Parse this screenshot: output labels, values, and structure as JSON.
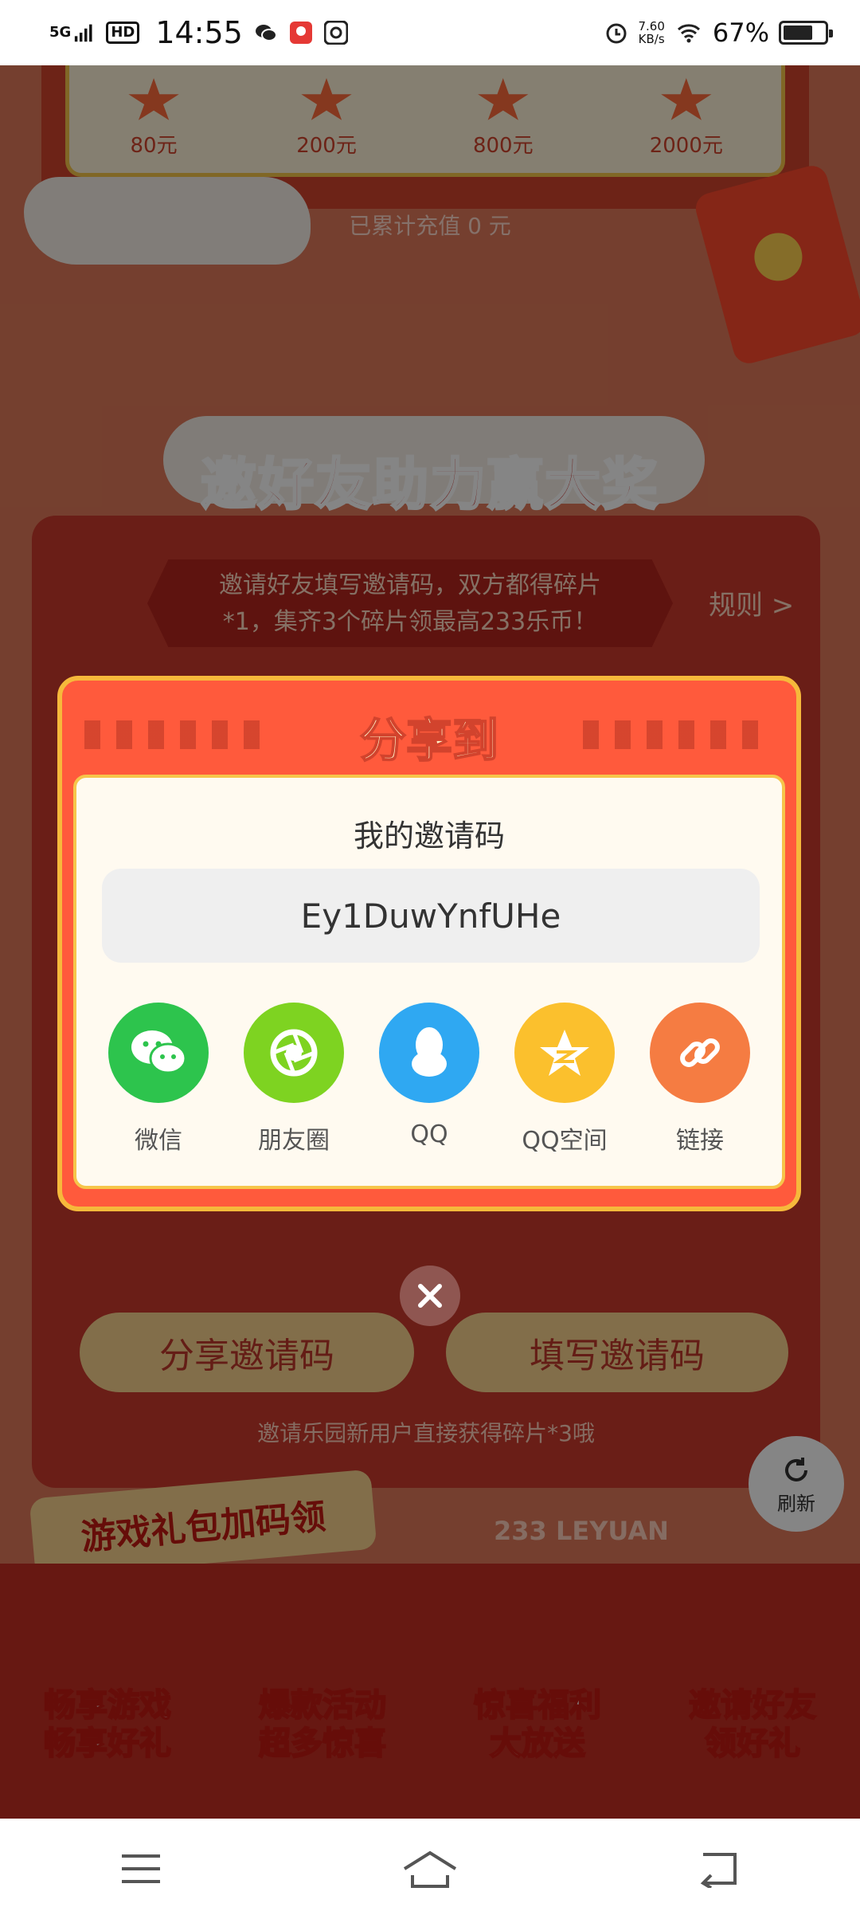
{
  "status_bar": {
    "network": "5G",
    "hd": "HD",
    "time": "14:55",
    "speed_value": "7.60",
    "speed_unit": "KB/s",
    "battery": "67%"
  },
  "background": {
    "tiers": [
      "80元",
      "200元",
      "800元",
      "2000元"
    ],
    "recharge_text": "已累计充值 0 元",
    "section_title": "邀好友助力赢大奖",
    "invite_desc_line1": "邀请好友填写邀请码，双方都得碎片",
    "invite_desc_line2": "*1，集齐3个碎片领最高233乐币！",
    "rules_link": "规则 >",
    "share_code_button": "分享邀请码",
    "fill_code_button": "填写邀请码",
    "invite_note": "邀请乐园新用户直接获得碎片*3哦",
    "gift_tag": "游戏礼包加码领",
    "brand_strip": "233 LEYUAN",
    "refresh_label": "刷新",
    "promos": [
      {
        "line1": "畅享游戏",
        "line2": "畅享好礼"
      },
      {
        "line1": "爆款活动",
        "line2": "超多惊喜"
      },
      {
        "line1": "惊喜福利",
        "line2": "大放送"
      },
      {
        "line1": "邀请好友",
        "line2": "领好礼"
      }
    ]
  },
  "dialog": {
    "title": "分享到",
    "code_label": "我的邀请码",
    "invite_code": "Ey1DuwYnfUHe",
    "share_targets": [
      {
        "label": "微信",
        "icon": "wechat-icon",
        "color": "#2dc44d"
      },
      {
        "label": "朋友圈",
        "icon": "moments-icon",
        "color": "#7ed321"
      },
      {
        "label": "QQ",
        "icon": "qq-icon",
        "color": "#2fa8f2"
      },
      {
        "label": "QQ空间",
        "icon": "qzone-icon",
        "color": "#fbc02d"
      },
      {
        "label": "链接",
        "icon": "link-icon",
        "color": "#f57c42"
      }
    ]
  }
}
